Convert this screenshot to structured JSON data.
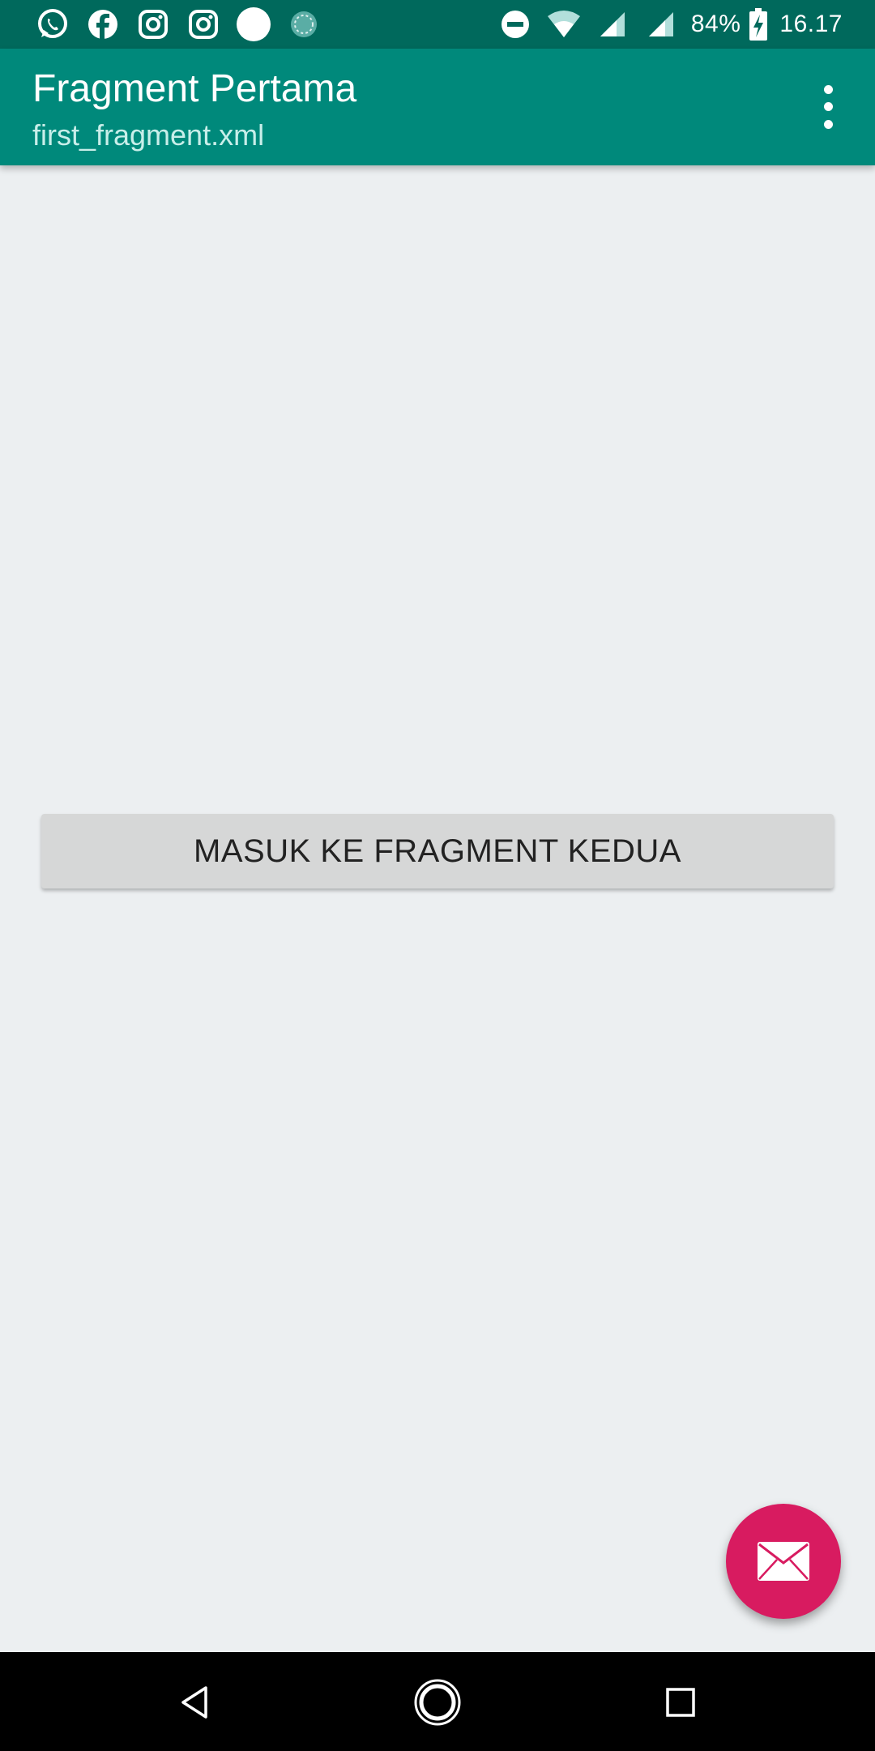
{
  "status_bar": {
    "battery": "84%",
    "time": "16.17",
    "notification_icons": [
      "whatsapp-icon",
      "facebook-icon",
      "instagram-icon",
      "instagram-icon",
      "circle-icon",
      "loading-icon"
    ],
    "system_icons": [
      "do-not-disturb-icon",
      "wifi-icon",
      "signal-icon",
      "signal-icon",
      "battery-charging-icon"
    ]
  },
  "app_bar": {
    "title": "Fragment Pertama",
    "subtitle": "first_fragment.xml",
    "menu_icon": "more-vert-icon"
  },
  "main": {
    "button_label": "MASUK KE FRAGMENT KEDUA"
  },
  "fab": {
    "icon": "mail-icon"
  },
  "nav_bar": {
    "icons": [
      "back-icon",
      "home-icon",
      "recents-icon"
    ]
  },
  "colors": {
    "status_bar": "#00695C",
    "app_bar": "#00897B",
    "background": "#ECEFF1",
    "fab": "#D81B60",
    "button": "#D6D7D7"
  }
}
